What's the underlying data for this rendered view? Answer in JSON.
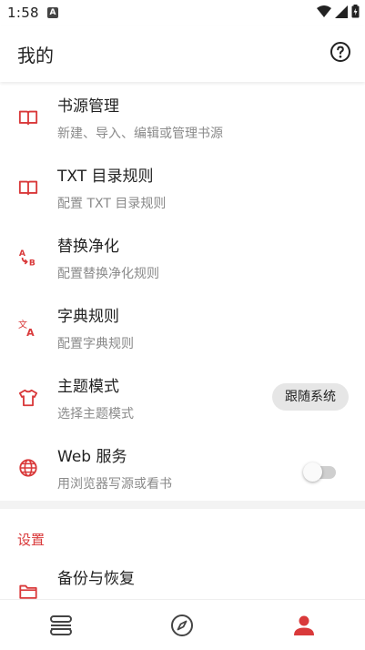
{
  "status_bar": {
    "time": "1:58",
    "notification_letter": "A"
  },
  "app_bar": {
    "title": "我的"
  },
  "colors": {
    "accent": "#d9393a",
    "subtitle": "#8a8a8a",
    "title": "#222222"
  },
  "items": [
    {
      "icon": "book-open-icon",
      "title": "书源管理",
      "subtitle": "新建、导入、编辑或管理书源"
    },
    {
      "icon": "book-open-icon",
      "title": "TXT 目录规则",
      "subtitle": "配置 TXT 目录规则"
    },
    {
      "icon": "replace-icon",
      "title": "替换净化",
      "subtitle": "配置替换净化规则"
    },
    {
      "icon": "translate-icon",
      "title": "字典规则",
      "subtitle": "配置字典规则"
    },
    {
      "icon": "tshirt-icon",
      "title": "主题模式",
      "subtitle": "选择主题模式",
      "value": "跟随系统"
    },
    {
      "icon": "globe-icon",
      "title": "Web 服务",
      "subtitle": "用浏览器写源或看书",
      "toggle_on": false
    }
  ],
  "settings": {
    "header": "设置",
    "items": [
      {
        "icon": "folder-icon",
        "title": "备份与恢复"
      }
    ]
  },
  "bottom_nav": [
    {
      "icon": "bookshelf-icon",
      "active": false
    },
    {
      "icon": "compass-icon",
      "active": false
    },
    {
      "icon": "person-icon",
      "active": true
    }
  ]
}
